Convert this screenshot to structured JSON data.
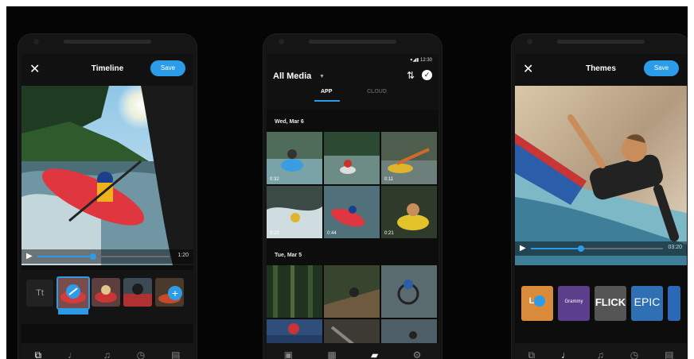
{
  "colors": {
    "accent": "#2d9ce8",
    "background": "#050505"
  },
  "timeline": {
    "close_icon": "close-icon",
    "title": "Timeline",
    "save_label": "Save",
    "time": "1:20",
    "progress": 0.42,
    "text_tool": "Tt",
    "add_icon": "plus-icon",
    "nav": [
      "clip-icon",
      "music-note-icon",
      "audio-icon",
      "timer-icon",
      "format-icon"
    ],
    "active_nav": 0
  },
  "media": {
    "status": "12:30",
    "title": "All Media",
    "tabs": [
      "APP",
      "CLOUD"
    ],
    "active_tab": 0,
    "sort_icon": "sort-icon",
    "select_icon": "check-circle-icon",
    "sections": [
      {
        "date": "Wed, Mar 6",
        "durations": [
          "0:32",
          "",
          "0:11",
          "0:22",
          "0:44",
          "0:21"
        ]
      },
      {
        "date": "Tue, Mar 5",
        "durations": [
          "",
          "",
          "",
          "",
          "",
          ""
        ]
      }
    ],
    "nav": [
      "stories-icon",
      "grid-icon",
      "camera-icon",
      "settings-icon"
    ],
    "active_nav": 2
  },
  "themes": {
    "close_icon": "close-icon",
    "title": "Themes",
    "save_label": "Save",
    "time": "03:20",
    "progress": 0.38,
    "items": [
      "",
      "Grammy",
      "FLICK",
      "EPIC",
      ""
    ],
    "nav": [
      "clip-icon",
      "music-note-icon",
      "audio-icon",
      "timer-icon",
      "format-icon"
    ],
    "active_nav": 1
  }
}
